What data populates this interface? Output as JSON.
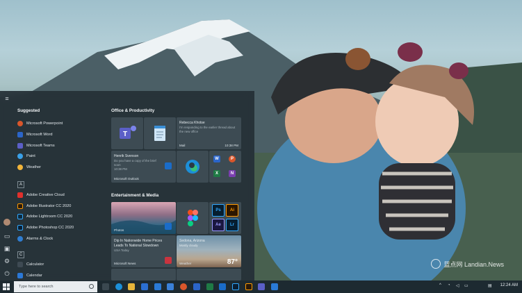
{
  "start_menu": {
    "suggested_heading": "Suggested",
    "suggested": [
      {
        "label": "Microsoft Powerpoint",
        "icon": "powerpoint-icon",
        "color": "#d9562b"
      },
      {
        "label": "Microsoft Word",
        "icon": "word-icon",
        "color": "#2b65c9"
      },
      {
        "label": "Microsoft Teams",
        "icon": "teams-icon",
        "color": "#5b5fc7"
      },
      {
        "label": "Paint",
        "icon": "paint-icon",
        "color": "#3aa0e8"
      },
      {
        "label": "Weather",
        "icon": "weather-icon",
        "color": "#f2b53a"
      }
    ],
    "letter_a": "A",
    "apps_a": [
      {
        "label": "Adobe Creative Cloud",
        "icon": "creative-cloud-icon",
        "color": "#e0302c"
      },
      {
        "label": "Adobe Illustrator CC 2020",
        "icon": "illustrator-icon",
        "color": "#2a1a0a"
      },
      {
        "label": "Adobe Lightroom CC 2020",
        "icon": "lightroom-icon",
        "color": "#0e2a3d"
      },
      {
        "label": "Adobe Photoshop CC 2020",
        "icon": "photoshop-icon",
        "color": "#0a1f33"
      },
      {
        "label": "Alarms & Clock",
        "icon": "alarm-clock-icon",
        "color": "#2f7dd1"
      }
    ],
    "letter_c": "C",
    "apps_c": [
      {
        "label": "Calculator",
        "icon": "calculator-icon",
        "color": "#3e4a53"
      },
      {
        "label": "Calendar",
        "icon": "calendar-icon",
        "color": "#2b78d6"
      }
    ],
    "tiles": {
      "office_heading": "Office & Productivity",
      "mail": {
        "sender": "Rebecca Khotse",
        "preview": "I'm responding to the earlier thread about the new office",
        "app": "Mail",
        "time": "10:38 PM"
      },
      "outlook": {
        "sender": "Henrik Svenson",
        "preview": "Do you have a copy of the brief soon",
        "time": "10:38 PM",
        "app": "Microsoft Outlook"
      },
      "minis": [
        {
          "glyph": "W",
          "icon": "word-icon",
          "color": "#2b65c9"
        },
        {
          "glyph": "P",
          "icon": "powerpoint-icon",
          "color": "#d9562b"
        },
        {
          "glyph": "X",
          "icon": "excel-icon",
          "color": "#1f7a45"
        },
        {
          "glyph": "N",
          "icon": "onenote-icon",
          "color": "#7b3fb0"
        }
      ],
      "entertainment_heading": "Entertainment & Media",
      "photos": {
        "label": "Photos"
      },
      "adobe": [
        {
          "glyph": "Ps",
          "icon": "photoshop-icon",
          "color": "#31a8ff"
        },
        {
          "glyph": "Ai",
          "icon": "illustrator-icon",
          "color": "#ff9a00"
        },
        {
          "glyph": "Ae",
          "icon": "after-effects-icon",
          "color": "#9999ff"
        },
        {
          "glyph": "Lr",
          "icon": "lightroom-icon",
          "color": "#31a8ff"
        }
      ],
      "news": {
        "headline": "Dip In Nationwide Home Prices Leads To National Slowdown",
        "source": "USA Today",
        "app": "Microsoft News"
      },
      "weather": {
        "city": "Sedona, Arizona",
        "condition": "Mostly cloudy",
        "app": "Weather",
        "temp": "87°"
      }
    }
  },
  "taskbar": {
    "search_placeholder": "Type here to search",
    "pinned": [
      {
        "icon": "task-view-icon",
        "color": "#3a4850"
      },
      {
        "icon": "edge-icon",
        "color": "#1c8fd8"
      },
      {
        "icon": "file-explorer-icon",
        "color": "#e5b43a"
      },
      {
        "icon": "store-icon",
        "color": "#2b6fd1"
      },
      {
        "icon": "mail-icon",
        "color": "#2a7ad6"
      },
      {
        "icon": "calendar-icon",
        "color": "#3a80d8"
      },
      {
        "icon": "powerpoint-icon",
        "color": "#d9562b"
      },
      {
        "icon": "word-icon",
        "color": "#2b65c9"
      },
      {
        "icon": "excel-icon",
        "color": "#1f7a45"
      },
      {
        "icon": "outlook-icon",
        "color": "#1a6cc8"
      },
      {
        "icon": "photoshop-icon",
        "color": "#0a1f33"
      },
      {
        "icon": "illustrator-icon",
        "color": "#2a1a0a"
      },
      {
        "icon": "teams-icon",
        "color": "#5b5fc7"
      },
      {
        "icon": "outlook-icon",
        "color": "#2a7ad6"
      }
    ],
    "time": "12:24 AM"
  },
  "watermark": {
    "text": "蓝点网 Landian.News"
  }
}
